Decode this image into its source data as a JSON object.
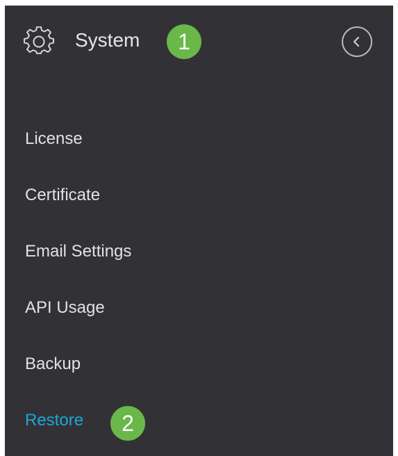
{
  "header": {
    "icon": "gear-icon",
    "title": "System",
    "step_badge": "1",
    "collapse_icon": "chevron-left-icon"
  },
  "menu": {
    "items": [
      {
        "label": "License",
        "active": false
      },
      {
        "label": "Certificate",
        "active": false
      },
      {
        "label": "Email Settings",
        "active": false
      },
      {
        "label": "API Usage",
        "active": false
      },
      {
        "label": "Backup",
        "active": false
      },
      {
        "label": "Restore",
        "active": true
      }
    ],
    "step_badge": "2"
  },
  "colors": {
    "panel_bg": "#323236",
    "text": "#e2e2e2",
    "active_text": "#1ba6d9",
    "badge": "#6ab74a"
  }
}
